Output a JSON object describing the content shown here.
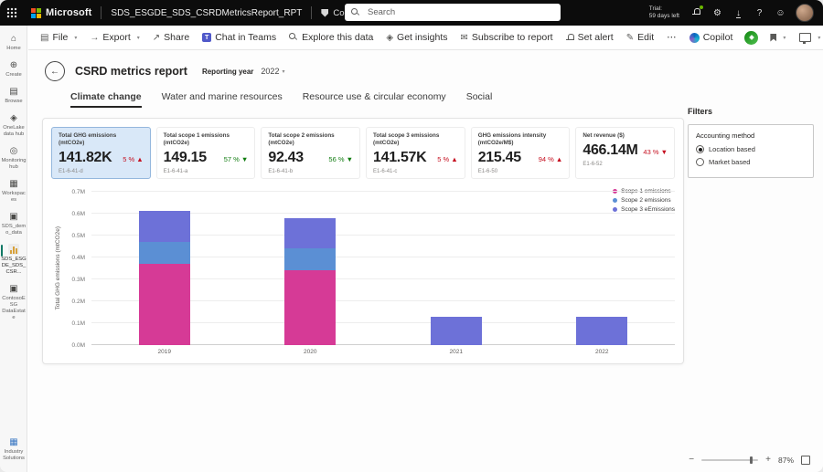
{
  "topbar": {
    "brand": "Microsoft",
    "report_name": "SDS_ESGDE_SDS_CSRDMetricsReport_RPT",
    "sensitivity": "Confidential\\Microsoft Extended",
    "search_placeholder": "Search",
    "trial_label": "Trial:",
    "trial_value": "59 days left"
  },
  "toolbar": {
    "items": [
      {
        "label": "File",
        "icon": "file",
        "dropdown": true
      },
      {
        "label": "Export",
        "icon": "export",
        "dropdown": true
      },
      {
        "label": "Share",
        "icon": "share"
      },
      {
        "label": "Chat in Teams",
        "icon": "teams"
      },
      {
        "label": "Explore this data",
        "icon": "explore"
      },
      {
        "label": "Get insights",
        "icon": "insights"
      },
      {
        "label": "Subscribe to report",
        "icon": "subscribe"
      },
      {
        "label": "Set alert",
        "icon": "alert"
      },
      {
        "label": "Edit",
        "icon": "edit"
      },
      {
        "label": "⋯",
        "icon": "more"
      }
    ],
    "copilot_label": "Copilot"
  },
  "sidebar": {
    "items": [
      {
        "label": "Home",
        "icon": "home"
      },
      {
        "label": "Create",
        "icon": "create"
      },
      {
        "label": "Browse",
        "icon": "browse"
      },
      {
        "label": "OneLake data hub",
        "icon": "onelake"
      },
      {
        "label": "Monitoring hub",
        "icon": "monitoring"
      },
      {
        "label": "Workspaces",
        "icon": "workspaces"
      },
      {
        "label": "SDS_demo_data",
        "icon": "workspace"
      },
      {
        "label": "SDS_ESGDE_SDS_CSR...",
        "icon": "report",
        "active": true
      },
      {
        "label": "ContosoESG DataEstate",
        "icon": "workspace"
      }
    ],
    "bottom_item": {
      "label": "Industry Solutions",
      "icon": "industry"
    }
  },
  "report": {
    "title": "CSRD metrics report",
    "reporting_year_label": "Reporting year",
    "reporting_year_value": "2022",
    "tabs": [
      {
        "label": "Climate change",
        "active": true
      },
      {
        "label": "Water and marine resources"
      },
      {
        "label": "Resource use & circular economy"
      },
      {
        "label": "Social"
      }
    ]
  },
  "kpi_cards": [
    {
      "title": "Total GHG emissions (mtCO2e)",
      "value": "141.82K",
      "delta": "5 %",
      "dir": "up",
      "trend": "bad",
      "code": "E1-6-41-d",
      "selected": true
    },
    {
      "title": "Total scope 1 emissions (mtCO2e)",
      "value": "149.15",
      "delta": "57 %",
      "dir": "down",
      "trend": "good",
      "code": "E1-6-41-a"
    },
    {
      "title": "Total scope 2 emissions (mtCO2e)",
      "value": "92.43",
      "delta": "56 %",
      "dir": "down",
      "trend": "good",
      "code": "E1-6-41-b"
    },
    {
      "title": "Total scope 3 emissions (mtCO2e)",
      "value": "141.57K",
      "delta": "5 %",
      "dir": "up",
      "trend": "bad",
      "code": "E1-6-41-c"
    },
    {
      "title": "GHG emissions intensity (mtCO2e/M$)",
      "value": "215.45",
      "delta": "94 %",
      "dir": "up",
      "trend": "bad",
      "code": "E1-6-50"
    },
    {
      "title": "Net revenue ($)",
      "value": "466.14M",
      "delta": "43 %",
      "dir": "down",
      "trend": "bad",
      "code": "E1-6-52"
    }
  ],
  "colors": {
    "bad": "#c50f1f",
    "good": "#107c10",
    "accent": "#0078d4"
  },
  "chart_data": {
    "type": "bar",
    "stacked": true,
    "categories": [
      "2019",
      "2020",
      "2021",
      "2022"
    ],
    "series": [
      {
        "name": "Scope 1 emissions",
        "color": "#d63a96",
        "values": [
          0.37,
          0.34,
          0,
          0
        ]
      },
      {
        "name": "Scope 2 emissions",
        "color": "#5b8fd4",
        "values": [
          0.1,
          0.1,
          0,
          0
        ]
      },
      {
        "name": "Scope 3 eEmissions",
        "color": "#6d71d8",
        "values": [
          0.14,
          0.14,
          0.13,
          0.13
        ]
      }
    ],
    "ylabel": "Total GHG emissions (mtCO2e)",
    "y_ticks": [
      "0.0M",
      "0.1M",
      "0.2M",
      "0.3M",
      "0.4M",
      "0.5M",
      "0.6M",
      "0.7M"
    ],
    "ylim": [
      0,
      0.7
    ],
    "unit": "M mtCO2e",
    "grid": true,
    "legend_position": "top-right"
  },
  "filters": {
    "title": "Filters",
    "group": "Accounting method",
    "options": [
      {
        "label": "Location based",
        "selected": true
      },
      {
        "label": "Market based",
        "selected": false
      }
    ]
  },
  "statusbar": {
    "zoom_level": "87%"
  }
}
